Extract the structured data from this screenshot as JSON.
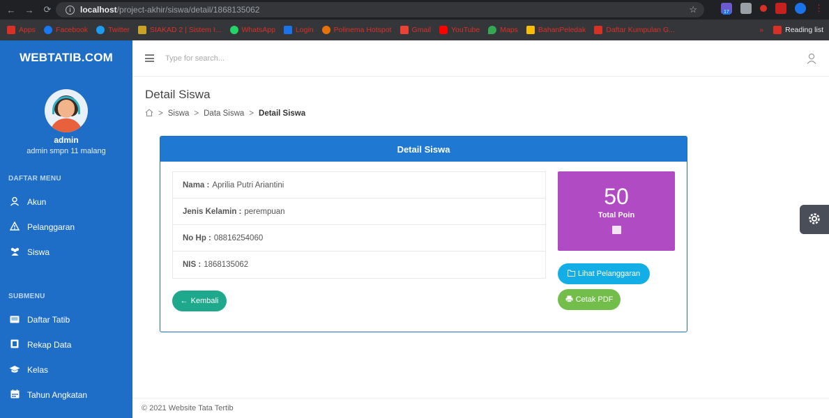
{
  "browser": {
    "url_host": "localhost",
    "url_path": "/project-akhir/siswa/detail/1868135062",
    "bookmarks": [
      "Apps",
      "Facebook",
      "Twitter",
      "SIAKAD 2 | Sistem I...",
      "WhatsApp",
      "Login",
      "Polinema Hotspot",
      "Gmail",
      "YouTube",
      "Maps",
      "BahanPeledak",
      "Daftar Kumpulan G..."
    ],
    "reading_list": "Reading list",
    "more": "»",
    "ext_badge": "17"
  },
  "sidebar": {
    "brand": "WEBTATIB.COM",
    "user_name": "admin",
    "user_sub": "admin smpn 11 malang",
    "menu_head": "DAFTAR MENU",
    "menu": [
      {
        "label": "Akun",
        "icon": "user-icon"
      },
      {
        "label": "Pelanggaran",
        "icon": "warning-icon"
      },
      {
        "label": "Siswa",
        "icon": "users-icon"
      }
    ],
    "submenu_head": "SUBMENU",
    "submenu": [
      {
        "label": "Daftar Tatib",
        "icon": "list-icon"
      },
      {
        "label": "Rekap Data",
        "icon": "file-icon"
      },
      {
        "label": "Kelas",
        "icon": "graduation-cap-icon"
      },
      {
        "label": "Tahun Angkatan",
        "icon": "calendar-icon"
      }
    ]
  },
  "topbar": {
    "search_placeholder": "Type for search..."
  },
  "page": {
    "title": "Detail Siswa",
    "breadcrumb": [
      "Siswa",
      "Data Siswa",
      "Detail Siswa"
    ]
  },
  "card": {
    "title": "Detail Siswa",
    "fields": [
      {
        "label": "Nama :",
        "value": "Aprilia Putri Ariantini"
      },
      {
        "label": "Jenis Kelamin :",
        "value": "perempuan"
      },
      {
        "label": "No Hp :",
        "value": "08816254060"
      },
      {
        "label": "NIS :",
        "value": "1868135062"
      }
    ],
    "poin_value": "50",
    "poin_label": "Total Poin",
    "btn_lihat": "Lihat Pelanggaran",
    "btn_cetak": "Cetak PDF",
    "btn_kembali": "Kembali"
  },
  "footer": "© 2021 Website Tata Tertib",
  "colors": {
    "sidebar": "#1e6ec8",
    "card_header": "#1f79d3",
    "poin_box": "#b14bc4",
    "btn_lihat": "#14aee6",
    "btn_cetak": "#73be4b",
    "btn_kembali": "#1fa98c"
  }
}
